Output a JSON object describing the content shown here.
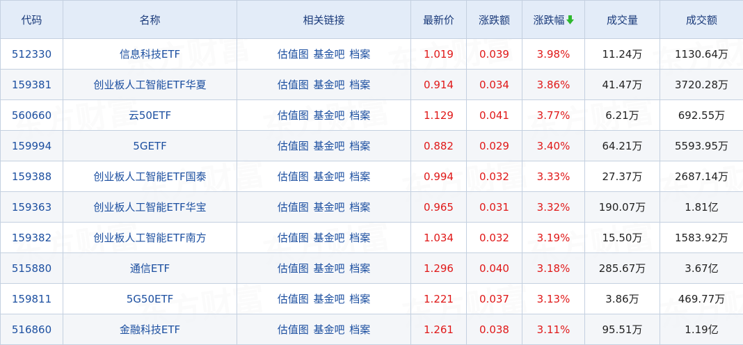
{
  "columns": {
    "code": "代码",
    "name": "名称",
    "links": "相关链接",
    "price": "最新价",
    "change": "涨跌额",
    "pct": "涨跌幅",
    "volume": "成交量",
    "amount": "成交额"
  },
  "sort_icon": "arrow-down-icon",
  "colors": {
    "header_bg": "#e3ecf8",
    "up": "#e01818",
    "link": "#1c4fa0",
    "sort_arrow": "#2eb82e"
  },
  "link_labels": [
    "估值图",
    "基金吧",
    "档案"
  ],
  "rows": [
    {
      "code": "512330",
      "name": "信息科技ETF",
      "links": [
        "估值图",
        "基金吧",
        "档案"
      ],
      "price": "1.019",
      "change": "0.039",
      "pct": "3.98%",
      "volume": "11.24万",
      "amount": "1130.64万"
    },
    {
      "code": "159381",
      "name": "创业板人工智能ETF华夏",
      "links": [
        "估值图",
        "基金吧",
        "档案"
      ],
      "price": "0.914",
      "change": "0.034",
      "pct": "3.86%",
      "volume": "41.47万",
      "amount": "3720.28万"
    },
    {
      "code": "560660",
      "name": "云50ETF",
      "links": [
        "估值图",
        "基金吧",
        "档案"
      ],
      "price": "1.129",
      "change": "0.041",
      "pct": "3.77%",
      "volume": "6.21万",
      "amount": "692.55万"
    },
    {
      "code": "159994",
      "name": "5GETF",
      "links": [
        "估值图",
        "基金吧",
        "档案"
      ],
      "price": "0.882",
      "change": "0.029",
      "pct": "3.40%",
      "volume": "64.21万",
      "amount": "5593.95万"
    },
    {
      "code": "159388",
      "name": "创业板人工智能ETF国泰",
      "links": [
        "估值图",
        "基金吧",
        "档案"
      ],
      "price": "0.994",
      "change": "0.032",
      "pct": "3.33%",
      "volume": "27.37万",
      "amount": "2687.14万"
    },
    {
      "code": "159363",
      "name": "创业板人工智能ETF华宝",
      "links": [
        "估值图",
        "基金吧",
        "档案"
      ],
      "price": "0.965",
      "change": "0.031",
      "pct": "3.32%",
      "volume": "190.07万",
      "amount": "1.81亿"
    },
    {
      "code": "159382",
      "name": "创业板人工智能ETF南方",
      "links": [
        "估值图",
        "基金吧",
        "档案"
      ],
      "price": "1.034",
      "change": "0.032",
      "pct": "3.19%",
      "volume": "15.50万",
      "amount": "1583.92万"
    },
    {
      "code": "515880",
      "name": "通信ETF",
      "links": [
        "估值图",
        "基金吧",
        "档案"
      ],
      "price": "1.296",
      "change": "0.040",
      "pct": "3.18%",
      "volume": "285.67万",
      "amount": "3.67亿"
    },
    {
      "code": "159811",
      "name": "5G50ETF",
      "links": [
        "估值图",
        "基金吧",
        "档案"
      ],
      "price": "1.221",
      "change": "0.037",
      "pct": "3.13%",
      "volume": "3.86万",
      "amount": "469.77万"
    },
    {
      "code": "516860",
      "name": "金融科技ETF",
      "links": [
        "估值图",
        "基金吧",
        "档案"
      ],
      "price": "1.261",
      "change": "0.038",
      "pct": "3.11%",
      "volume": "95.51万",
      "amount": "1.19亿"
    }
  ],
  "watermark": "东方财富"
}
